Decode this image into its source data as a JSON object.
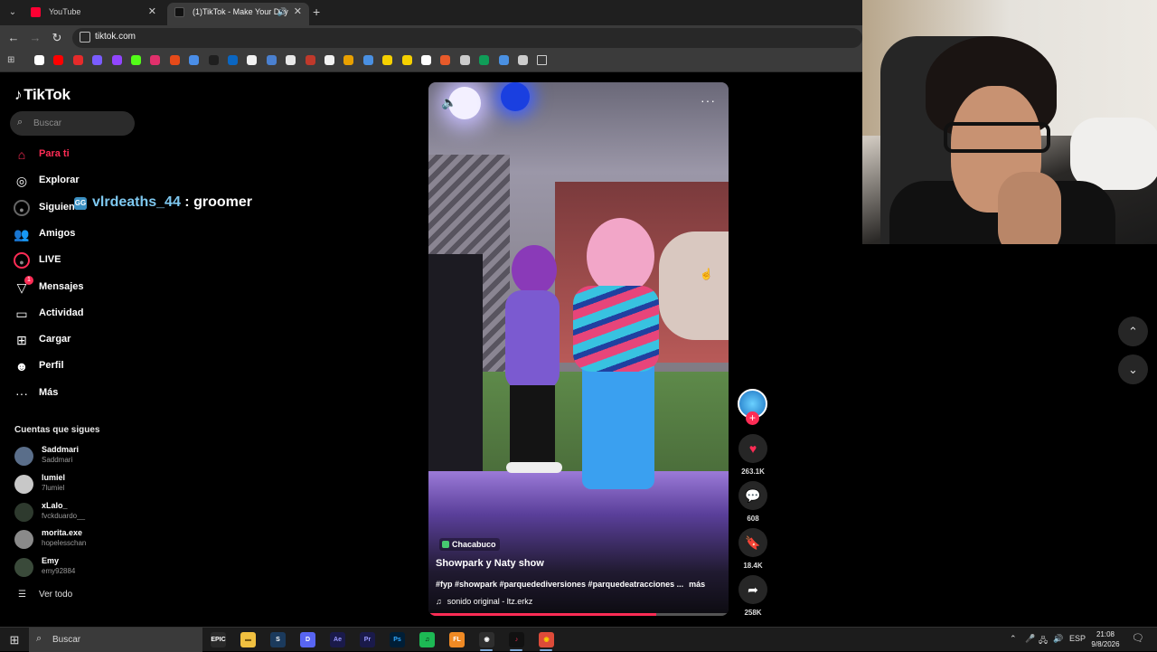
{
  "browser": {
    "tabs": [
      {
        "title": "YouTube",
        "close": "✕",
        "favicon_color": "#ff0033"
      },
      {
        "title": "(1)TikTok - Make Your Day",
        "close": "✕",
        "favicon_color": "#111111"
      }
    ],
    "new_tab": "+",
    "url": "tiktok.com",
    "bookmark_colors": [
      "#ffffff",
      "#ff0000",
      "#e62b2b",
      "#7a5cff",
      "#9146ff",
      "#53fc18",
      "#e1306c",
      "#e64a19",
      "#4a8ee8",
      "#1f1f1f",
      "#0a66c2",
      "#f2f2f2",
      "#4a80d0",
      "#e8e8e8",
      "#c0392b",
      "#f2f2f2",
      "#e8a000",
      "#4a90e2",
      "#f5d000",
      "#f5d000",
      "#ffffff",
      "#e85a2a",
      "#cccccc",
      "#0f9d58",
      "#4a90e2",
      "#cccccc"
    ]
  },
  "sidebar": {
    "logo": "TikTok",
    "search_placeholder": "Buscar",
    "nav": [
      {
        "label": "Para ti",
        "icon": "⌂",
        "icon_name": "home-icon",
        "active": true
      },
      {
        "label": "Explorar",
        "icon": "◎",
        "icon_name": "compass-icon"
      },
      {
        "label": "Siguiendo",
        "icon": "●",
        "icon_name": "following-avatar-icon"
      },
      {
        "label": "Amigos",
        "icon": "👥",
        "icon_name": "friends-icon"
      },
      {
        "label": "LIVE",
        "icon": "●",
        "icon_name": "live-icon"
      },
      {
        "label": "Mensajes",
        "icon": "▽",
        "icon_name": "messages-icon",
        "badge": "1"
      },
      {
        "label": "Actividad",
        "icon": "▭",
        "icon_name": "activity-icon"
      },
      {
        "label": "Cargar",
        "icon": "⊞",
        "icon_name": "upload-icon"
      },
      {
        "label": "Perfil",
        "icon": "☻",
        "icon_name": "profile-icon"
      },
      {
        "label": "Más",
        "icon": "···",
        "icon_name": "more-icon"
      }
    ],
    "following_title": "Cuentas que sigues",
    "accounts": [
      {
        "name": "Saddmari",
        "handle": "Saddmari"
      },
      {
        "name": "lumiel",
        "handle": "7lumiel"
      },
      {
        "name": "xLalo_",
        "handle": "fvckduardo__"
      },
      {
        "name": "morita.exe",
        "handle": "hopelesschan"
      },
      {
        "name": "Emy",
        "handle": "emy92884"
      }
    ],
    "see_all": "Ver todo"
  },
  "chat_overlay": {
    "user": "vlrdeaths_44",
    "separator": ":",
    "message": "groomer"
  },
  "video": {
    "location": "Chacabuco",
    "title": "Showpark y Naty show",
    "hashtags": "#fyp #showpark #parquedediversiones #parquedeatracciones ...",
    "more": "más",
    "sound_icon": "♫",
    "sound": "sonido original - ltz.erkz",
    "progress": 0.76,
    "more_menu": "···"
  },
  "actions": {
    "likes": "263.1K",
    "comments": "608",
    "saves": "18.4K",
    "shares": "258K",
    "follow_plus": "+"
  },
  "feed_nav": {
    "up": "⌃",
    "down": "⌄"
  },
  "taskbar": {
    "search_placeholder": "Buscar",
    "apps": [
      {
        "name": "epic",
        "label": "EPIC",
        "bg": "#2a2a2a",
        "fg": "#ffffff"
      },
      {
        "name": "explorer",
        "label": "▬",
        "bg": "#f0c040",
        "fg": "#7a5a10"
      },
      {
        "name": "steam",
        "label": "S",
        "bg": "#1b3a5c",
        "fg": "#ffffff"
      },
      {
        "name": "discord",
        "label": "D",
        "bg": "#5865f2",
        "fg": "#ffffff"
      },
      {
        "name": "after-effects",
        "label": "Ae",
        "bg": "#1a1a4a",
        "fg": "#9999ff"
      },
      {
        "name": "premiere",
        "label": "Pr",
        "bg": "#1a1a4a",
        "fg": "#9999ff"
      },
      {
        "name": "photoshop",
        "label": "Ps",
        "bg": "#001e36",
        "fg": "#31a8ff"
      },
      {
        "name": "spotify",
        "label": "♫",
        "bg": "#1db954",
        "fg": "#000000"
      },
      {
        "name": "fl-studio",
        "label": "FL",
        "bg": "#f08a24",
        "fg": "#ffffff"
      },
      {
        "name": "obs",
        "label": "◉",
        "bg": "#2e2e2e",
        "fg": "#ffffff"
      },
      {
        "name": "tiktok",
        "label": "♪",
        "bg": "#111111",
        "fg": "#fe2c55"
      },
      {
        "name": "chrome",
        "label": "◉",
        "bg": "#dd4b39",
        "fg": "#f5d000"
      }
    ],
    "language": "ESP",
    "time": "21:08",
    "date": "9/8/2026"
  }
}
